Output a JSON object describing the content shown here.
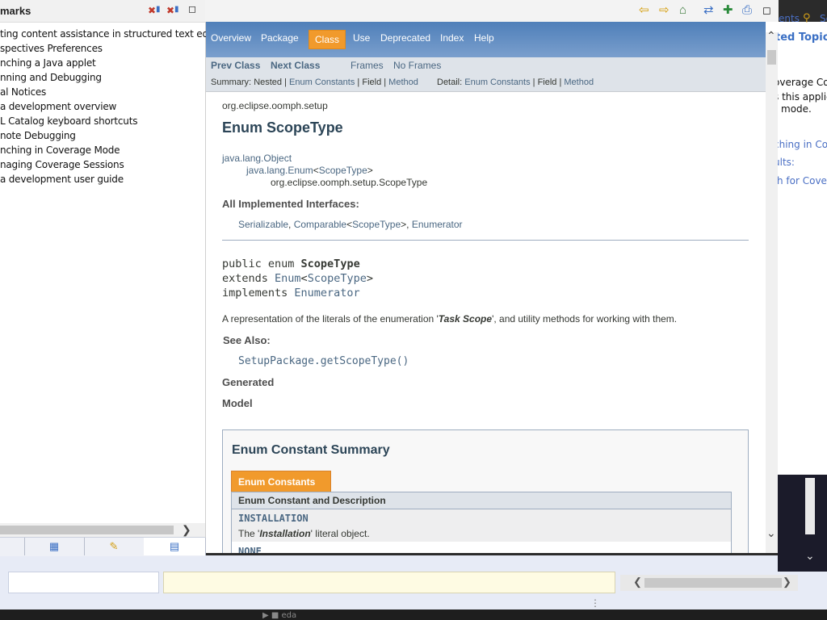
{
  "left_panel": {
    "title": "marks",
    "items": [
      "ting content assistance in structured text editors",
      "spectives Preferences",
      "nching a Java applet",
      "nning and Debugging",
      "al Notices",
      "a development overview",
      "L Catalog keyboard shortcuts",
      "note Debugging",
      "nching in Coverage Mode",
      "naging Coverage Sessions",
      "a development user guide"
    ]
  },
  "right_strip": {
    "contents_label": "ents",
    "search_label": "Se",
    "related_title": "ted Topics",
    "lines": [
      "overage Co",
      "s this applic",
      "mode."
    ],
    "links": [
      "ching in Co",
      "ults:",
      "h for Cover"
    ]
  },
  "navbar": {
    "items": [
      "Overview",
      "Package",
      "Class",
      "Use",
      "Deprecated",
      "Index",
      "Help"
    ],
    "active": "Class"
  },
  "subnav": {
    "prev_class": "Prev Class",
    "next_class": "Next Class",
    "frames": "Frames",
    "no_frames": "No Frames",
    "summary_label": "Summary:",
    "summary_nested": "Nested",
    "summary_links": [
      "Enum Constants",
      "Field",
      "Method"
    ],
    "detail_label": "Detail:",
    "detail_links": [
      "Enum Constants",
      "Field",
      "Method"
    ],
    "separator": "|"
  },
  "doc": {
    "package": "org.eclipse.oomph.setup",
    "title": "Enum ScopeType",
    "inheritance": {
      "object": "java.lang.Object",
      "enum": "java.lang.Enum",
      "enum_type": "ScopeType",
      "self": "org.eclipse.oomph.setup.ScopeType"
    },
    "implemented_label": "All Implemented Interfaces:",
    "interfaces": {
      "serializable": "Serializable",
      "comparable": "Comparable",
      "comparable_type": "ScopeType",
      "enumerator": "Enumerator"
    },
    "signature": {
      "line1_prefix": "public enum ",
      "line1_name": "ScopeType",
      "line2_prefix": "extends ",
      "line2_enum": "Enum",
      "line2_type": "ScopeType",
      "line3_prefix": "implements ",
      "line3_iface": "Enumerator"
    },
    "description_prefix": "A representation of the literals of the enumeration '",
    "description_em": "Task Scope",
    "description_suffix": "', and utility methods for working with them.",
    "see_also_label": "See Also:",
    "see_also_link": "SetupPackage.getScopeType()",
    "generated": "Generated",
    "model": "Model"
  },
  "summary": {
    "title": "Enum Constant Summary",
    "tab": "Enum Constants",
    "column_header": "Enum Constant and Description",
    "rows": [
      {
        "name": "INSTALLATION",
        "desc_prefix": "The '",
        "desc_em": "Installation",
        "desc_suffix": "' literal object."
      },
      {
        "name": "NONE"
      }
    ]
  },
  "taskbar": {
    "label": "eda"
  }
}
